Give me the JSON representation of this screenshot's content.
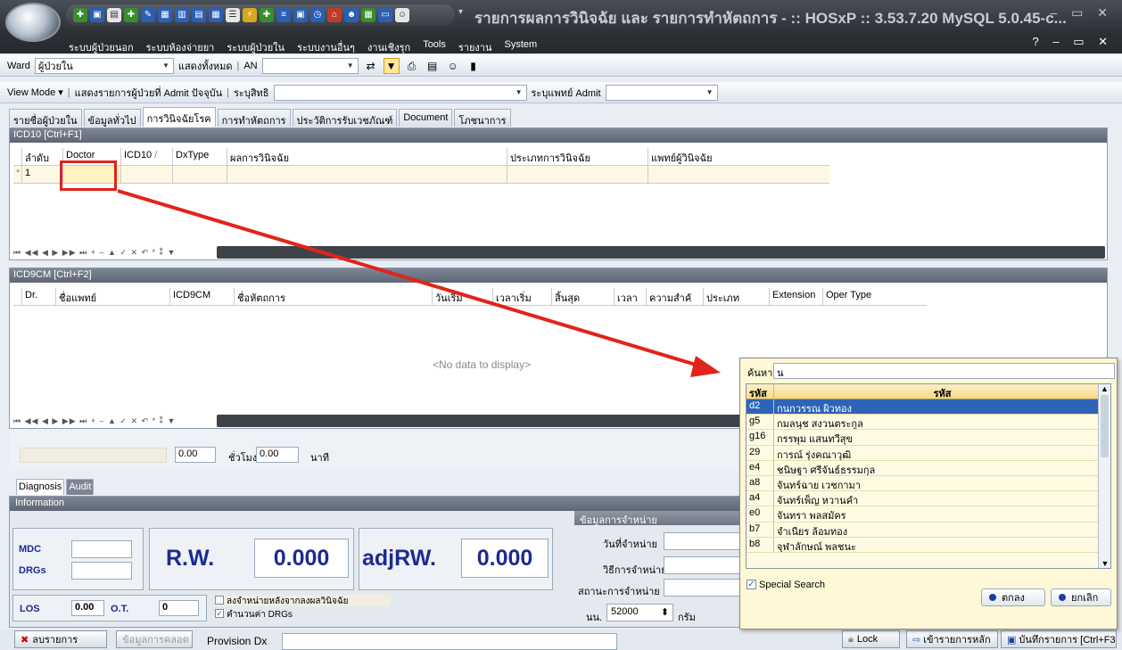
{
  "window": {
    "title": "รายการผลการวินิจฉัย และ รายการทำหัตถการ - :: HOSxP :: 3.53.7.20 MySQL 5.0.45-c...",
    "controls": "– ▭ ✕"
  },
  "menu": {
    "items": [
      "ระบบผู้ป่วยนอก",
      "ระบบห้องจ่ายยา",
      "ระบบผู้ป่วยใน",
      "ระบบงานอื่นๆ",
      "งานเชิงรุก",
      "Tools",
      "รายงาน",
      "System"
    ],
    "right_controls": "? – ▭ ✕"
  },
  "toolbar1": {
    "ward_label": "Ward",
    "ward_value": "ผู้ป่วยใน",
    "show_all_label": "แสดงทั้งหมด",
    "an_label": "AN",
    "an_value": ""
  },
  "toolbar2": {
    "view_mode_label": "View Mode",
    "current_admit_label": "แสดงรายการผู้ป่วยที่ Admit ปัจจุบัน",
    "right_label": "ระบุสิทธิ",
    "right_value": "",
    "doctor_admit_label": "ระบุแพทย์ Admit",
    "doctor_admit_value": ""
  },
  "tabs": [
    "รายชื่อผู้ป่วยใน",
    "ข้อมูลทั่วไป",
    "การวินิจฉัยโรค",
    "การทำหัตถการ",
    "ประวัติการรับเวชภัณฑ์",
    "Document",
    "โภชนาการ"
  ],
  "selected_tab": 2,
  "icd10": {
    "header": "ICD10 [Ctrl+F1]",
    "columns": [
      "ลำดับ",
      "Doctor",
      "ICD10",
      "DxType",
      "ผลการวินิจฉัย",
      "ประเภทการวินิจฉัย",
      "แพทย์ผู้วินิจฉัย"
    ],
    "row_number": "1",
    "sort_indicator": "/",
    "row_marker": "*"
  },
  "icd9": {
    "header": "ICD9CM [Ctrl+F2]",
    "columns": [
      "Dr.",
      "ชื่อแพทย์",
      "ICD9CM",
      "ชื่อหัตถการ",
      "วันเริ่ม",
      "เวลาเริ่ม",
      "สิ้นสุด",
      "เวลา",
      "ความสำคั",
      "ประเภท",
      "Extension",
      "Oper Type"
    ],
    "empty_text": "<No data to display>"
  },
  "navigator": "⏮ ◀◀ ◀ ▶ ▶▶ ⏭ + – ▲ ✓ ✕ ↶ * ⁑ ▼",
  "duration": {
    "hours_value": "0.00",
    "hours_label": "ชั่วโมง",
    "minutes_value": "0.00",
    "minutes_label": "นาที"
  },
  "bottom_tabs": [
    "Diagnosis",
    "Audit"
  ],
  "information": {
    "header": "Information",
    "mdc_label": "MDC",
    "drgs_label": "DRGs",
    "rw_label": "R.W.",
    "rw_value": "0.000",
    "adjrw_label": "adjRW.",
    "adjrw_value": "0.000",
    "los_label": "LOS",
    "los_value": "0.00",
    "ot_label": "O.T.",
    "ot_value": "0",
    "chk_discharge_label": "ลงจำหน่ายหลังจากลงผลวินิจฉัย",
    "chk_calc_drg_label": "คำนวนค่า DRGs"
  },
  "discharge": {
    "header": "ข้อมูลการจำหน่าย",
    "date_label": "วันที่จำหน่าย",
    "method_label": "วิธีการจำหน่าย",
    "status_label": "สถานะการจำหน่าย",
    "weight_label": "นน.",
    "weight_value": "52000",
    "weight_unit": "กรัม"
  },
  "footer": {
    "delete_label": "ลบรายการ",
    "detail_label": "ข้อมูลการคลอด",
    "provision_label": "Provision Dx",
    "lock_label": "Lock",
    "main_label": "เข้ารายการหลัก",
    "save_label": "บันทึกรายการ [Ctrl+F3"
  },
  "popup": {
    "search_label": "ค้นหา",
    "search_value": "น",
    "col_code": "รหัส",
    "col_name": "รหัส",
    "rows": [
      {
        "code": "d2",
        "name": "กนกวรรณ ผิวทอง"
      },
      {
        "code": "g5",
        "name": "กมลนุช สงวนตระกูล"
      },
      {
        "code": "g16",
        "name": "กรรพุม แสนทวีสุข"
      },
      {
        "code": "29",
        "name": "การณ์ รุ่งคณาวุฒิ"
      },
      {
        "code": "e4",
        "name": "ชนิษฐา ศรีจันธ์ธรรมกุล"
      },
      {
        "code": "a8",
        "name": "จันทร์ฉาย เวชกามา"
      },
      {
        "code": "a4",
        "name": "จันทร์เพ็ญ หวานคำ"
      },
      {
        "code": "e0",
        "name": "จันทรา พลสมัคร"
      },
      {
        "code": "b7",
        "name": "จำเนียร ล้อมทอง"
      },
      {
        "code": "b8",
        "name": "จุฬาลักษณ์ พลชนะ"
      }
    ],
    "special_search_label": "Special Search",
    "ok_label": "ตกลง",
    "cancel_label": "ยกเลิก"
  },
  "colors": {
    "annotation": "#e2231a",
    "title_text": "#c7ccd3",
    "rw_text": "#1d2b8f",
    "selection": "#2d64b8"
  }
}
